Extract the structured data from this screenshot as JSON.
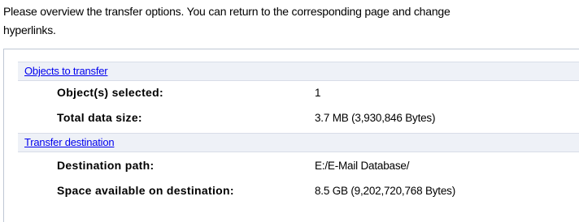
{
  "intro_text": "Please overview the transfer options. You can return to the corresponding page and change\nhyperlinks.",
  "sections": [
    {
      "title": "Objects to transfer",
      "rows": [
        {
          "label": "Object(s) selected:",
          "value": "1"
        },
        {
          "label": "Total data size:",
          "value": "3.7 MB (3,930,846 Bytes)"
        }
      ]
    },
    {
      "title": "Transfer destination",
      "rows": [
        {
          "label": "Destination path:",
          "value": "E:/E-Mail Database/"
        },
        {
          "label": "Space available on destination:",
          "value": "8.5 GB (9,202,720,768 Bytes)"
        }
      ]
    }
  ],
  "colors": {
    "link": "#0000ee",
    "section_header_bg": "#eef1f7",
    "panel_border": "#bfc7d4"
  }
}
